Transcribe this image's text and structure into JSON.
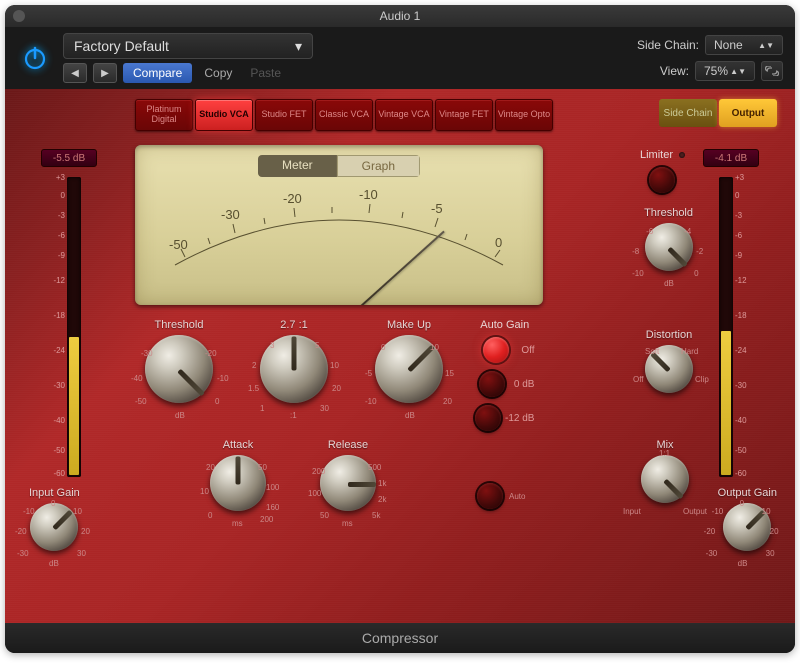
{
  "window": {
    "title": "Audio 1"
  },
  "toolbar": {
    "preset": "Factory Default",
    "compare": "Compare",
    "copy": "Copy",
    "paste": "Paste",
    "sidechain_label": "Side Chain:",
    "sidechain_value": "None",
    "view_label": "View:",
    "view_value": "75%"
  },
  "tabs": {
    "models": [
      "Platinum Digital",
      "Studio VCA",
      "Studio FET",
      "Classic VCA",
      "Vintage VCA",
      "Vintage FET",
      "Vintage Opto"
    ],
    "active": 1,
    "sidechain": "Side Chain",
    "output": "Output"
  },
  "vu": {
    "meter": "Meter",
    "graph": "Graph",
    "scale": [
      "-50",
      "-30",
      "-20",
      "-10",
      "-5",
      "0"
    ]
  },
  "meters": {
    "input_label": "Input Gain",
    "output_label": "Output Gain",
    "input_db": "-5.5 dB",
    "output_db": "-4.1 dB",
    "ticks": [
      "+3",
      "0",
      "-3",
      "-6",
      "-9",
      "-12",
      "-18",
      "-24",
      "-30",
      "-40",
      "-50",
      "-60"
    ]
  },
  "knobs": {
    "threshold": {
      "label": "Threshold",
      "unit": "dB",
      "ticks": [
        "-50",
        "-40",
        "-30",
        "-20",
        "-10",
        "0"
      ]
    },
    "ratio": {
      "label": "2.7 :1",
      "ticks": [
        "1",
        "1.5",
        "2",
        "3",
        "4",
        "5",
        "7",
        "10",
        "15",
        "20",
        "30"
      ]
    },
    "makeup": {
      "label": "Make Up",
      "unit": "dB",
      "ticks": [
        "-10",
        "-5",
        "0",
        "5",
        "10",
        "15",
        "20"
      ]
    },
    "attack": {
      "label": "Attack",
      "unit": "ms",
      "ticks": [
        "0",
        "10",
        "20",
        "50",
        "100",
        "160",
        "200"
      ]
    },
    "release": {
      "label": "Release",
      "unit": "ms",
      "ticks": [
        "50",
        "100",
        "200",
        "500",
        "1k",
        "2k",
        "5k"
      ]
    },
    "limiter_threshold": {
      "label": "Threshold",
      "unit": "dB",
      "ticks": [
        "-10",
        "-8",
        "-6",
        "-4",
        "-2",
        "0"
      ]
    },
    "distortion": {
      "label": "Distortion",
      "ticks": [
        "Off",
        "Soft",
        "Hard",
        "Clip"
      ]
    },
    "mix": {
      "label": "Mix",
      "ticks": [
        "Input",
        "1:1",
        "Output"
      ]
    },
    "input_gain_ticks": [
      "-30",
      "-20",
      "-10",
      "0",
      "10",
      "20",
      "30"
    ],
    "input_gain_unit": "dB",
    "output_gain_ticks": [
      "-30",
      "-20",
      "-10",
      "0",
      "10",
      "20",
      "30"
    ],
    "output_gain_unit": "dB"
  },
  "autogain": {
    "label": "Auto Gain",
    "options": [
      "Off",
      "0 dB",
      "-12 dB"
    ],
    "auto": "Auto"
  },
  "limiter": {
    "label": "Limiter"
  },
  "footer": "Compressor"
}
